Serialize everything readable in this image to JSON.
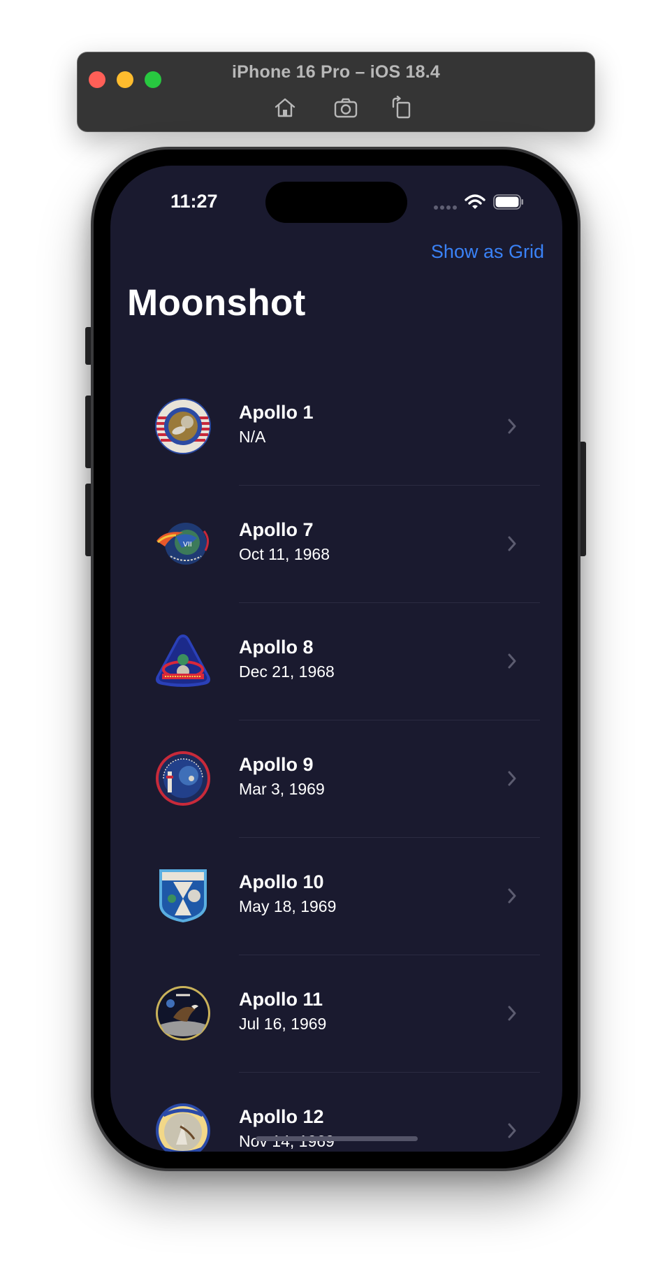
{
  "simulator": {
    "title": "iPhone 16 Pro – iOS 18.4",
    "toolbar": [
      "home-icon",
      "screenshot-icon",
      "rotate-icon"
    ]
  },
  "status_bar": {
    "time": "11:27"
  },
  "nav": {
    "action_label": "Show as Grid",
    "title": "Moonshot"
  },
  "missions": [
    {
      "name": "Apollo 1",
      "date": "N/A"
    },
    {
      "name": "Apollo 7",
      "date": "Oct 11, 1968"
    },
    {
      "name": "Apollo 8",
      "date": "Dec 21, 1968"
    },
    {
      "name": "Apollo 9",
      "date": "Mar 3, 1969"
    },
    {
      "name": "Apollo 10",
      "date": "May 18, 1969"
    },
    {
      "name": "Apollo 11",
      "date": "Jul 16, 1969"
    },
    {
      "name": "Apollo 12",
      "date": "Nov 14, 1969"
    }
  ],
  "colors": {
    "background": "#1a1a2f",
    "accent": "#3a82f7",
    "divider": "#2b2b42"
  }
}
